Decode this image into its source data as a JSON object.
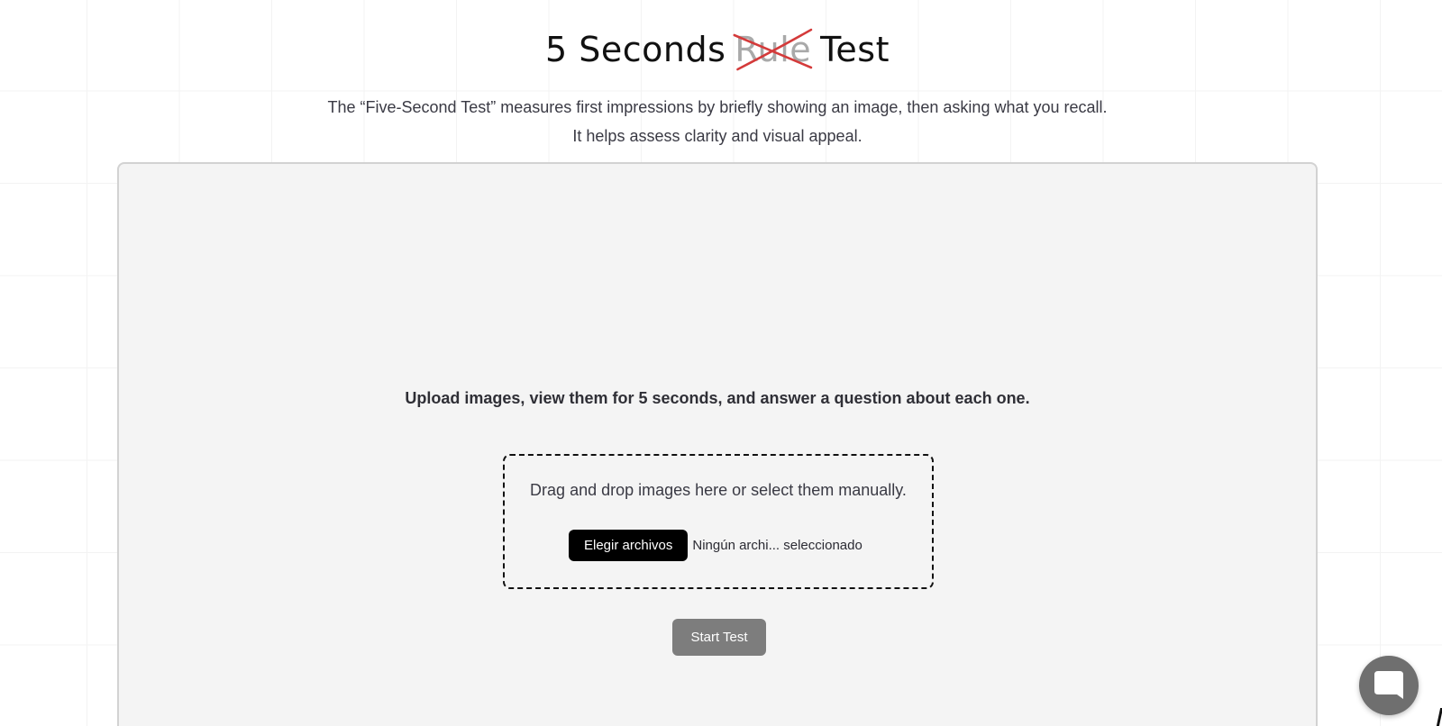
{
  "header": {
    "title_prefix": "5 Seconds",
    "title_struck": "Rule",
    "title_suffix": "Test",
    "subtitle": "The “Five-Second Test” measures first impressions by briefly showing an image, then asking what you recall. It helps assess clarity and visual appeal."
  },
  "panel": {
    "instructions": "Upload images, view them for 5 seconds, and answer a question about each one.",
    "dropzone": {
      "text": "Drag and drop images here or select them manually.",
      "file_button_label": "Elegir archivos",
      "file_status": "Ningún archi... seleccionado"
    },
    "start_button_label": "Start Test"
  },
  "colors": {
    "strike": "#d43a3a",
    "button_dark": "#000000",
    "start_button": "#7d7d7d",
    "panel_bg": "#f4f4f4"
  },
  "icons": {
    "chat": "chat-bubble-icon",
    "strike": "strikethrough-cross-icon"
  }
}
